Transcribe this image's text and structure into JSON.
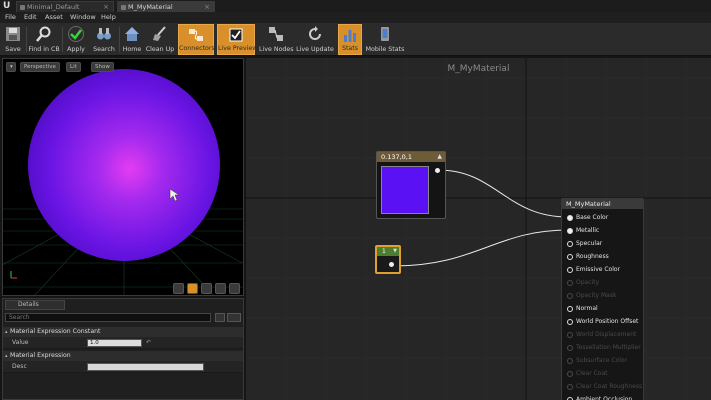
{
  "tabs": [
    {
      "label": "Minimal_Default",
      "active": false
    },
    {
      "label": "M_MyMaterial",
      "active": true
    }
  ],
  "menu": [
    "File",
    "Edit",
    "Asset",
    "Window",
    "Help"
  ],
  "toolbar": [
    {
      "label": "Save",
      "icon": "save-icon",
      "on": false
    },
    {
      "label": "Find in CB",
      "icon": "magnifier-icon",
      "on": false
    },
    {
      "label": "Apply",
      "icon": "checkmark-icon",
      "on": false
    },
    {
      "label": "Search",
      "icon": "binoculars-icon",
      "on": false
    },
    {
      "label": "Home",
      "icon": "home-icon",
      "on": false
    },
    {
      "label": "Clean Up",
      "icon": "broom-icon",
      "on": false
    },
    {
      "label": "Connectors",
      "icon": "connectors-icon",
      "on": true
    },
    {
      "label": "Live Preview",
      "icon": "checkbox-icon",
      "on": true
    },
    {
      "label": "Live Nodes",
      "icon": "nodes-icon",
      "on": false
    },
    {
      "label": "Live Update",
      "icon": "refresh-icon",
      "on": false
    },
    {
      "label": "Stats",
      "icon": "stats-icon",
      "on": true
    },
    {
      "label": "Mobile Stats",
      "icon": "mobile-stats-icon",
      "on": false
    }
  ],
  "viewport": {
    "perspective_label": "Perspective",
    "lit_label": "Lit",
    "show_label": "Show"
  },
  "details": {
    "tab_label": "Details",
    "search_placeholder": "Search",
    "section1": "Material Expression Constant",
    "value_label": "Value",
    "value": "1.0",
    "section2": "Material Expression",
    "desc_label": "Desc"
  },
  "graph": {
    "title": "M_MyMaterial",
    "const3_title": "0.137,0,1",
    "const3_color": "#5a12f4",
    "const_title": "1",
    "material_title": "M_MyMaterial",
    "pins": [
      {
        "label": "Base Color",
        "state": "connected"
      },
      {
        "label": "Metallic",
        "state": "connected"
      },
      {
        "label": "Specular",
        "state": "enabled"
      },
      {
        "label": "Roughness",
        "state": "enabled"
      },
      {
        "label": "Emissive Color",
        "state": "enabled"
      },
      {
        "label": "Opacity",
        "state": "disabled"
      },
      {
        "label": "Opacity Mask",
        "state": "disabled"
      },
      {
        "label": "Normal",
        "state": "enabled"
      },
      {
        "label": "World Position Offset",
        "state": "enabled"
      },
      {
        "label": "World Displacement",
        "state": "disabled"
      },
      {
        "label": "Tessellation Multiplier",
        "state": "disabled"
      },
      {
        "label": "Subsurface Color",
        "state": "disabled"
      },
      {
        "label": "Clear Coat",
        "state": "disabled"
      },
      {
        "label": "Clear Coat Roughness",
        "state": "disabled"
      },
      {
        "label": "Ambient Occlusion",
        "state": "enabled"
      }
    ]
  },
  "colors": {
    "accent": "#d9902a",
    "sphere": "#7a16e6",
    "sphere_highlight": "#d83cf0"
  }
}
